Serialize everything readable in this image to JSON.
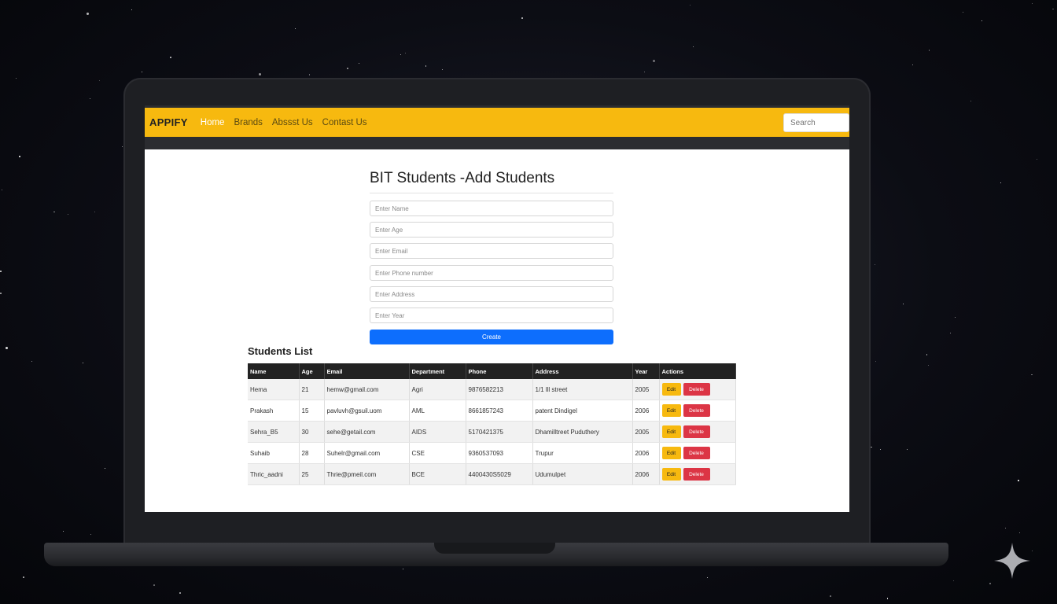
{
  "navbar": {
    "brand": "APPIFY",
    "links": [
      {
        "label": "Home",
        "active": true
      },
      {
        "label": "Brands",
        "active": false
      },
      {
        "label": "Abssst Us",
        "active": false
      },
      {
        "label": "Contast Us",
        "active": false
      }
    ],
    "search_placeholder": "Search"
  },
  "form": {
    "title": "BIT Students -Add Students",
    "fields": [
      {
        "placeholder": "Enter Name"
      },
      {
        "placeholder": "Enter Age"
      },
      {
        "placeholder": "Enter Email"
      },
      {
        "placeholder": "Enter Phone number"
      },
      {
        "placeholder": "Enter Address"
      },
      {
        "placeholder": "Enter Year"
      }
    ],
    "submit_label": "Create"
  },
  "students_list": {
    "title": "Students List",
    "columns": [
      "Name",
      "Age",
      "Email",
      "Department",
      "Phone",
      "Address",
      "Year",
      "Actions"
    ],
    "rows": [
      {
        "name": "Hema",
        "age": "21",
        "email": "hemw@gmail.com",
        "department": "Agri",
        "phone": "9876582213",
        "address": "1/1 lll street",
        "year": "2005"
      },
      {
        "name": "Prakash",
        "age": "15",
        "email": "pavluvh@gsuil.uom",
        "department": "AML",
        "phone": "8661857243",
        "address": "patent Dindigel",
        "year": "2006"
      },
      {
        "name": "Sehra_B5",
        "age": "30",
        "email": "sehe@getail.com",
        "department": "AIDS",
        "phone": "5170421375",
        "address": "Dhamilltreet Puduthery",
        "year": "2005"
      },
      {
        "name": "Suhaib",
        "age": "28",
        "email": "Suhelr@gmail.com",
        "department": "CSE",
        "phone": "9360537093",
        "address": "Trupur",
        "year": "2006"
      },
      {
        "name": "Thric_aadni",
        "age": "25",
        "email": "Thrie@pmeil.com",
        "department": "BCE",
        "phone": "4400430S5029",
        "address": "Udumulpet",
        "year": "2006"
      }
    ],
    "edit_label": "Edit",
    "delete_label": "Delete"
  }
}
